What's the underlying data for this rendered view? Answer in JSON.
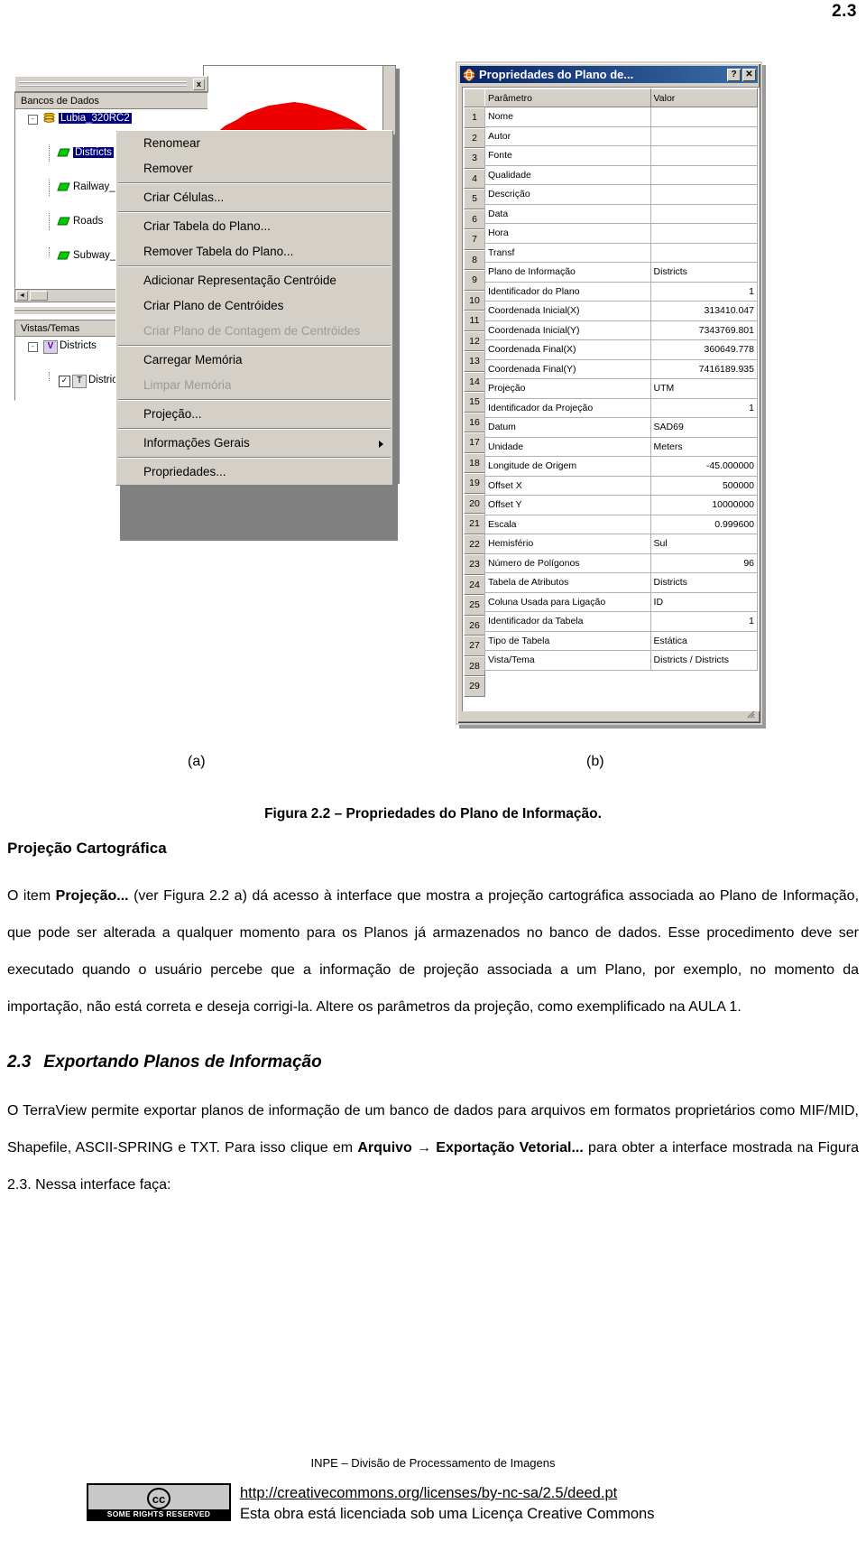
{
  "page_number": "2.3",
  "terraview_panel": {
    "close_icon": "x",
    "db_tree_header": "Bancos de Dados",
    "db_tree_nodes": [
      {
        "label": "Lubia_320RC2",
        "icon": "database-icon",
        "selected": true,
        "expander": "-"
      },
      {
        "label": "Districts",
        "icon": "layer-icon",
        "selected": true
      },
      {
        "label": "Railway_s",
        "icon": "layer-icon",
        "selected": false
      },
      {
        "label": "Roads",
        "icon": "layer-icon",
        "selected": false
      },
      {
        "label": "Subway_s",
        "icon": "layer-icon",
        "selected": false
      }
    ],
    "views_tree_header": "Vistas/Temas",
    "views_tree_nodes": [
      {
        "label": "Districts",
        "icon": "view-icon",
        "expander": "-"
      },
      {
        "label": "Distric",
        "icon": "theme-icon",
        "checked": true
      }
    ]
  },
  "context_menu": {
    "items": [
      {
        "label": "Renomear",
        "disabled": false,
        "submenu": false
      },
      {
        "label": "Remover",
        "disabled": false,
        "submenu": false
      },
      {
        "separator": true
      },
      {
        "label": "Criar Células...",
        "disabled": false,
        "submenu": false
      },
      {
        "separator": true
      },
      {
        "label": "Criar Tabela do Plano...",
        "disabled": false,
        "submenu": false
      },
      {
        "label": "Remover Tabela do Plano...",
        "disabled": false,
        "submenu": false
      },
      {
        "separator": true
      },
      {
        "label": "Adicionar Representação Centróide",
        "disabled": false,
        "submenu": false
      },
      {
        "label": "Criar Plano de Centróides",
        "disabled": false,
        "submenu": false
      },
      {
        "label": "Criar Plano de Contagem de Centróides",
        "disabled": true,
        "submenu": false
      },
      {
        "separator": true
      },
      {
        "label": "Carregar Memória",
        "disabled": false,
        "submenu": false
      },
      {
        "label": "Limpar Memória",
        "disabled": true,
        "submenu": false
      },
      {
        "separator": true
      },
      {
        "label": "Projeção...",
        "disabled": false,
        "submenu": false
      },
      {
        "separator": true
      },
      {
        "label": "Informações Gerais",
        "disabled": false,
        "submenu": true
      },
      {
        "separator": true
      },
      {
        "label": "Propriedades...",
        "disabled": false,
        "submenu": false
      }
    ]
  },
  "properties_dialog": {
    "title": "Propriedades do Plano de...",
    "icon": "terraview-globe-icon",
    "help_button": "?",
    "close_button": "✕",
    "columns": [
      "",
      "Parâmetro",
      "Valor"
    ],
    "rows": [
      {
        "n": "1",
        "param": "Nome",
        "value": "",
        "numeric": false
      },
      {
        "n": "2",
        "param": "Autor",
        "value": "",
        "numeric": false
      },
      {
        "n": "3",
        "param": "Fonte",
        "value": "",
        "numeric": false
      },
      {
        "n": "4",
        "param": "Qualidade",
        "value": "",
        "numeric": false
      },
      {
        "n": "5",
        "param": "Descrição",
        "value": "",
        "numeric": false
      },
      {
        "n": "6",
        "param": "Data",
        "value": "",
        "numeric": false
      },
      {
        "n": "7",
        "param": "Hora",
        "value": "",
        "numeric": false
      },
      {
        "n": "8",
        "param": "Transf",
        "value": "",
        "numeric": false
      },
      {
        "n": "9",
        "param": "Plano de Informação",
        "value": "Districts",
        "numeric": false
      },
      {
        "n": "10",
        "param": "Identificador do Plano",
        "value": "1",
        "numeric": true
      },
      {
        "n": "11",
        "param": "Coordenada Inicial(X)",
        "value": "313410.047",
        "numeric": true
      },
      {
        "n": "12",
        "param": "Coordenada Inicial(Y)",
        "value": "7343769.801",
        "numeric": true
      },
      {
        "n": "13",
        "param": "Coordenada Final(X)",
        "value": "360649.778",
        "numeric": true
      },
      {
        "n": "14",
        "param": "Coordenada Final(Y)",
        "value": "7416189.935",
        "numeric": true
      },
      {
        "n": "15",
        "param": "Projeção",
        "value": "UTM",
        "numeric": false
      },
      {
        "n": "16",
        "param": "Identificador da Projeção",
        "value": "1",
        "numeric": true
      },
      {
        "n": "17",
        "param": "Datum",
        "value": "SAD69",
        "numeric": false
      },
      {
        "n": "18",
        "param": "Unidade",
        "value": "Meters",
        "numeric": false
      },
      {
        "n": "19",
        "param": "Longitude de Origem",
        "value": "-45.000000",
        "numeric": true
      },
      {
        "n": "20",
        "param": "Offset X",
        "value": "500000",
        "numeric": true
      },
      {
        "n": "21",
        "param": "Offset Y",
        "value": "10000000",
        "numeric": true
      },
      {
        "n": "22",
        "param": "Escala",
        "value": "0.999600",
        "numeric": true
      },
      {
        "n": "23",
        "param": "Hemisfério",
        "value": "Sul",
        "numeric": false
      },
      {
        "n": "24",
        "param": "Número de Polígonos",
        "value": "96",
        "numeric": true
      },
      {
        "n": "25",
        "param": "Tabela de Atributos",
        "value": "Districts",
        "numeric": false
      },
      {
        "n": "26",
        "param": "Coluna Usada para Ligação",
        "value": "ID",
        "numeric": false
      },
      {
        "n": "27",
        "param": "Identificador da Tabela",
        "value": "1",
        "numeric": true
      },
      {
        "n": "28",
        "param": "Tipo de Tabela",
        "value": "Estática",
        "numeric": false
      },
      {
        "n": "29",
        "param": "Vista/Tema",
        "value": "Districts / Districts",
        "numeric": false
      }
    ]
  },
  "captions": {
    "sub_a": "(a)",
    "sub_b": "(b)",
    "figure": "Figura 2.2 – Propriedades do Plano de Informação."
  },
  "body": {
    "heading_projecao": "Projeção Cartográfica",
    "para1_a": "O item ",
    "para1_bold": "Projeção...",
    "para1_b": " (ver Figura 2.2 a) dá acesso à interface que mostra a projeção cartográfica associada ao Plano de Informação, que pode ser alterada a qualquer momento para os Planos já armazenados no banco de dados. Esse procedimento deve ser executado quando o usuário percebe que a informação de projeção associada a um Plano, por exemplo, no momento da importação, não está correta e deseja corrigi-la. Altere os parâmetros da projeção, como exemplificado na AULA 1.",
    "heading_23_num": "2.3",
    "heading_23_text": "Exportando Planos de Informação",
    "para2_a": "O TerraView permite exportar planos de informação de um banco de dados para arquivos em formatos proprietários como MIF/MID, Shapefile, ASCII-SPRING e TXT. Para isso clique em ",
    "para2_bold1": "Arquivo",
    "para2_arrow": " → ",
    "para2_bold2": "Exportação Vetorial...",
    "para2_b": " para obter a interface mostrada na Figura 2.3. Nessa interface faça:"
  },
  "footer": {
    "institution": "INPE – Divisão de Processamento de Imagens",
    "cc_mark": "cc",
    "cc_some_rights": "SOME RIGHTS RESERVED",
    "cc_url": "http://creativecommons.org/licenses/by-nc-sa/2.5/deed.pt",
    "cc_line": "Esta obra está licenciada sob uma Licença Creative Commons"
  },
  "colors": {
    "window_face": "#d4d0c8",
    "title_blue": "#0a246a",
    "selection_blue": "#000080",
    "map_red": "#ee0000"
  }
}
